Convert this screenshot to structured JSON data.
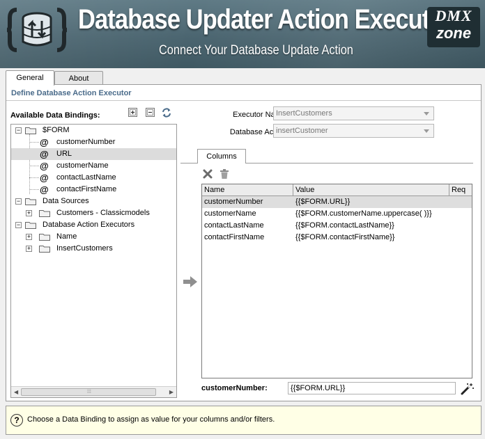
{
  "window": {
    "title": "Database Updater Action Executor",
    "subtitle": "Connect Your Database Update Action",
    "brand": {
      "line1": "DMX",
      "line2": "zone"
    }
  },
  "tabs": [
    {
      "label": "General",
      "active": true
    },
    {
      "label": "About",
      "active": false
    }
  ],
  "section_title": "Define Database Action Executor",
  "bindings": {
    "label": "Available Data Bindings:",
    "tools": [
      "expand-all-icon",
      "collapse-all-icon",
      "refresh-icon"
    ],
    "tree": [
      {
        "label": "$FORM",
        "type": "folder",
        "level": 0,
        "expanded": true
      },
      {
        "label": "customerNumber",
        "type": "field",
        "level": 1
      },
      {
        "label": "URL",
        "type": "field",
        "level": 1,
        "selected": true
      },
      {
        "label": "customerName",
        "type": "field",
        "level": 1
      },
      {
        "label": "contactLastName",
        "type": "field",
        "level": 1
      },
      {
        "label": "contactFirstName",
        "type": "field",
        "level": 1
      },
      {
        "label": "Data Sources",
        "type": "folder",
        "level": 0,
        "expanded": true
      },
      {
        "label": "Customers - Classicmodels",
        "type": "folder",
        "level": 1,
        "expanded": false
      },
      {
        "label": "Database Action Executors",
        "type": "folder",
        "level": 0,
        "expanded": true
      },
      {
        "label": "Name",
        "type": "folder",
        "level": 1,
        "expanded": false
      },
      {
        "label": "InsertCustomers",
        "type": "folder",
        "level": 1,
        "expanded": false
      }
    ]
  },
  "form": {
    "executor_name_label": "Executor Name:",
    "executor_name_value": "InsertCustomers",
    "database_action_label": "Database Action:",
    "database_action_value": "insertCustomer"
  },
  "columns_tab": "Columns",
  "grid": {
    "headers": [
      "Name",
      "Value",
      "Req"
    ],
    "rows": [
      {
        "name": "customerNumber",
        "value": "{{$FORM.URL}}",
        "selected": true
      },
      {
        "name": "customerName",
        "value": "{{$FORM.customerName.uppercase( )}}"
      },
      {
        "name": "contactLastName",
        "value": "{{$FORM.contactLastName}}"
      },
      {
        "name": "contactFirstName",
        "value": "{{$FORM.contactFirstName}}"
      }
    ]
  },
  "field": {
    "label": "customerNumber:",
    "value": "{{$FORM.URL}}"
  },
  "hint": {
    "text": "Choose a Data Binding to assign as value for your columns and/or filters."
  },
  "colors": {
    "banner": "#4f6973",
    "section_title": "#4a6b8a",
    "selection": "#dcdcdc",
    "hint_background": "#ffffe6"
  }
}
